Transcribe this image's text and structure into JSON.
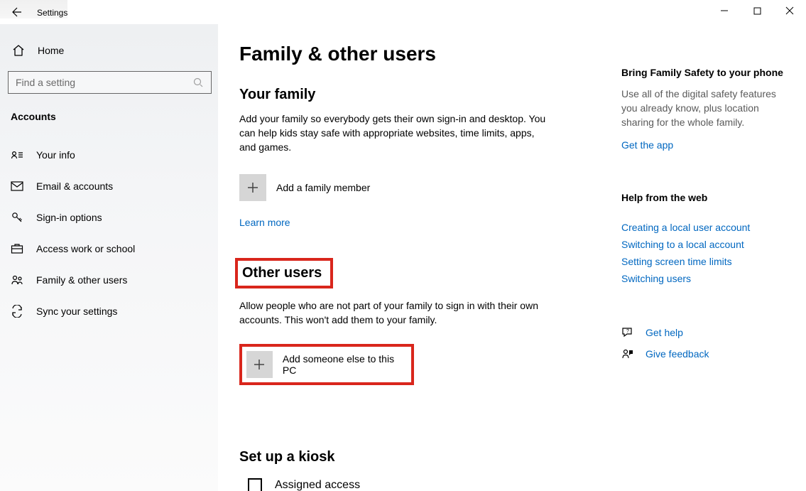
{
  "window": {
    "title": "Settings"
  },
  "sidebar": {
    "home": "Home",
    "search_placeholder": "Find a setting",
    "section": "Accounts",
    "items": [
      {
        "label": "Your info"
      },
      {
        "label": "Email & accounts"
      },
      {
        "label": "Sign-in options"
      },
      {
        "label": "Access work or school"
      },
      {
        "label": "Family & other users"
      },
      {
        "label": "Sync your settings"
      }
    ]
  },
  "main": {
    "page_title": "Family & other users",
    "family": {
      "heading": "Your family",
      "body": "Add your family so everybody gets their own sign-in and desktop. You can help kids stay safe with appropriate websites, time limits, apps, and games.",
      "add_label": "Add a family member",
      "learn_more": "Learn more"
    },
    "other_users": {
      "heading": "Other users",
      "body": "Allow people who are not part of your family to sign in with their own accounts. This won't add them to your family.",
      "add_label": "Add someone else to this PC"
    },
    "kiosk": {
      "heading": "Set up a kiosk",
      "assigned": "Assigned access"
    }
  },
  "aside": {
    "promo": {
      "heading": "Bring Family Safety to your phone",
      "body": "Use all of the digital safety features you already know, plus location sharing for the whole family.",
      "link": "Get the app"
    },
    "help": {
      "heading": "Help from the web",
      "links": [
        "Creating a local user account",
        "Switching to a local account",
        "Setting screen time limits",
        "Switching users"
      ]
    },
    "get_help": "Get help",
    "feedback": "Give feedback"
  }
}
